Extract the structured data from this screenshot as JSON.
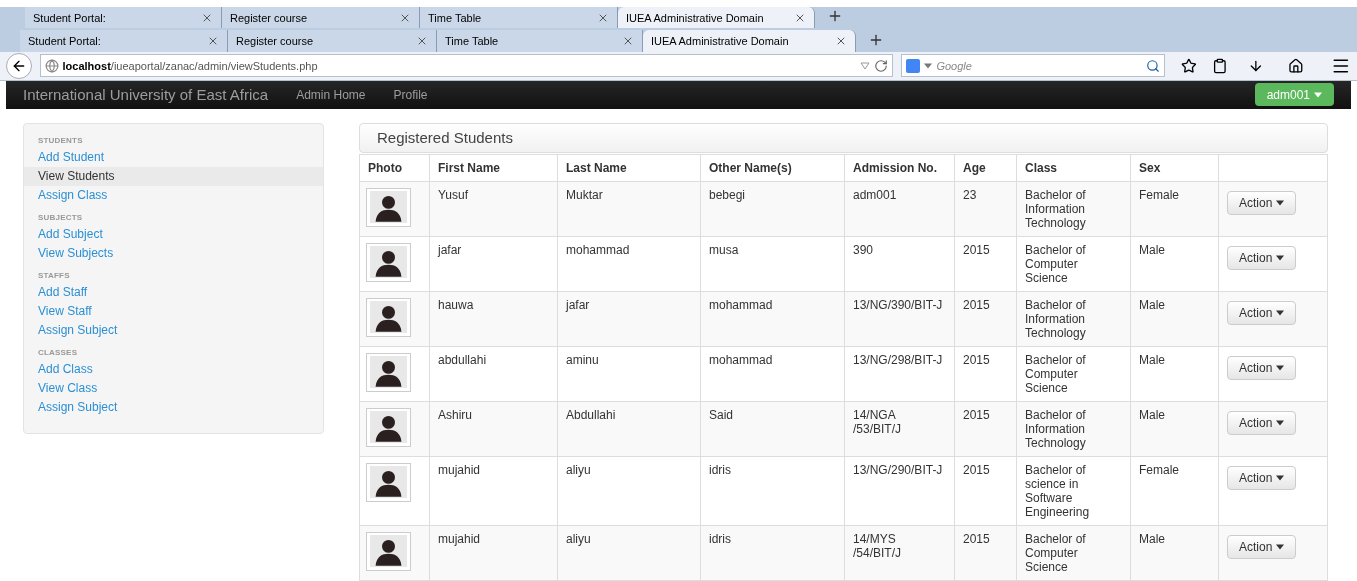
{
  "tab_strips": [
    {
      "tabs": [
        {
          "title": "Student Portal:",
          "selected": false
        },
        {
          "title": "Register course",
          "selected": false
        },
        {
          "title": "Time Table",
          "selected": false
        },
        {
          "title": "IUEA Administrative Domain",
          "selected": true
        }
      ]
    },
    {
      "tabs": [
        {
          "title": "Student Portal:",
          "selected": false
        },
        {
          "title": "Register course",
          "selected": false
        },
        {
          "title": "Time Table",
          "selected": false
        },
        {
          "title": "IUEA Administrative Domain",
          "selected": true
        }
      ]
    }
  ],
  "address_bar": {
    "host": "localhost",
    "path": "/iueaportal/zanac/admin/viewStudents.php"
  },
  "search": {
    "placeholder": "Google"
  },
  "navbar": {
    "brand": "International University of East Africa",
    "links": [
      "Admin Home",
      "Profile"
    ],
    "user": "adm001"
  },
  "sidebar": {
    "sections": [
      {
        "heading": "STUDENTS",
        "items": [
          {
            "label": "Add Student",
            "selected": false
          },
          {
            "label": "View Students",
            "selected": true
          },
          {
            "label": "Assign Class",
            "selected": false
          }
        ]
      },
      {
        "heading": "SUBJECTS",
        "items": [
          {
            "label": "Add Subject",
            "selected": false
          },
          {
            "label": "View Subjects",
            "selected": false
          }
        ]
      },
      {
        "heading": "STAFFS",
        "items": [
          {
            "label": "Add Staff",
            "selected": false
          },
          {
            "label": "View Staff",
            "selected": false
          },
          {
            "label": "Assign Subject",
            "selected": false
          }
        ]
      },
      {
        "heading": "CLASSES",
        "items": [
          {
            "label": "Add Class",
            "selected": false
          },
          {
            "label": "View Class",
            "selected": false
          },
          {
            "label": "Assign Subject",
            "selected": false
          }
        ]
      }
    ]
  },
  "panel": {
    "title": "Registered Students"
  },
  "table": {
    "columns": [
      "Photo",
      "First Name",
      "Last Name",
      "Other Name(s)",
      "Admission No.",
      "Age",
      "Class",
      "Sex"
    ],
    "rows": [
      {
        "first_name": "Yusuf",
        "last_name": "Muktar",
        "other_names": "bebegi",
        "admission_no": "adm001",
        "age": "23",
        "class": "Bachelor of Information Technology",
        "sex": "Female",
        "action": "Action"
      },
      {
        "first_name": "jafar",
        "last_name": "mohammad",
        "other_names": "musa",
        "admission_no": "390",
        "age": "2015",
        "class": "Bachelor of Computer Science",
        "sex": "Male",
        "action": "Action"
      },
      {
        "first_name": "hauwa",
        "last_name": "jafar",
        "other_names": "mohammad",
        "admission_no": "13/NG/390/BIT-J",
        "age": "2015",
        "class": "Bachelor of Information Technology",
        "sex": "Male",
        "action": "Action"
      },
      {
        "first_name": "abdullahi",
        "last_name": "aminu",
        "other_names": "mohammad",
        "admission_no": "13/NG/298/BIT-J",
        "age": "2015",
        "class": "Bachelor of Computer Science",
        "sex": "Male",
        "action": "Action"
      },
      {
        "first_name": "Ashiru",
        "last_name": "Abdullahi",
        "other_names": "Said",
        "admission_no": "14/NGA\n/53/BIT/J",
        "age": "2015",
        "class": "Bachelor of Information Technology",
        "sex": "Male",
        "action": "Action"
      },
      {
        "first_name": "mujahid",
        "last_name": "aliyu",
        "other_names": "idris",
        "admission_no": "13/NG/290/BIT-J",
        "age": "2015",
        "class": "Bachelor of science in Software Engineering",
        "sex": "Female",
        "action": "Action"
      },
      {
        "first_name": "mujahid",
        "last_name": "aliyu",
        "other_names": "idris",
        "admission_no": "14/MYS\n/54/BIT/J",
        "age": "2015",
        "class": "Bachelor of Computer Science",
        "sex": "Male",
        "action": "Action"
      }
    ]
  }
}
